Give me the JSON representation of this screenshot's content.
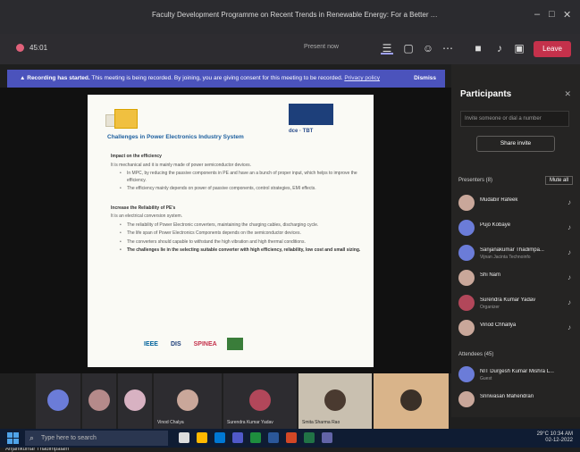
{
  "window": {
    "title": "Faculty Development Programme on Recent Trends in Renewable Energy: For a Better Tomorrow",
    "controls": [
      "–",
      "□",
      "✕"
    ]
  },
  "toolbar": {
    "timer": "45:01",
    "participants_search_hint": "Present now",
    "leave_label": "Leave"
  },
  "banner": {
    "bold": "Recording has started.",
    "text": "This meeting is being recorded. By joining, you are giving consent for this meeting to be recorded.",
    "link": "Privacy policy",
    "dismiss": "Dismiss"
  },
  "slide": {
    "heading": "Challenges in Power Electronics Industry System",
    "partners_text": "dce  ·  TBT",
    "section1_title": "Impact on the efficiency",
    "section1_text": "It is mechanical and it is mainly made of power semiconductor devices.",
    "bullets1": [
      "In MPC, by reducing the passive components in PE and have an a bunch of proper input, which helps to improve the efficiency.",
      "The efficiency mainly depends on power of passive components, control strategies, EMI effects."
    ],
    "section2_title": "Increase the Reliability of PE's",
    "section2_text": "It is an electrical conversion system.",
    "bullets2": [
      "The reliability of Power Electronic converters, maintaining the charging cables, discharging cycle.",
      "The life span of Power Electronics Components depends on the semiconductor devices.",
      "The converters should capable to withstand the high vibration and high thermal conditions.",
      "The challenges lie in the selecting suitable converter with high efficiency, reliability, low cost and small sizing."
    ],
    "footer_logos": [
      "IEEE",
      "DIS",
      "SPINEA"
    ]
  },
  "presenter_label": "Anjanikumar Thadimpalam",
  "panel": {
    "title": "Participants",
    "search_placeholder": "Invite someone or dial a number",
    "share_label": "Share invite",
    "presenters_label": "Presenters (8)",
    "mute_all": "Mute all",
    "attendees_label": "Attendees (45)",
    "participants": [
      {
        "name": "Mudabir Rafeek",
        "sub": ""
      },
      {
        "name": "Pujo Kobaye",
        "sub": ""
      },
      {
        "name": "Sanjanakumar Thadimpa...",
        "sub": "Vijnan Jacinta Technoinfo"
      },
      {
        "name": "Shi Nam",
        "sub": ""
      },
      {
        "name": "Surendra Kumar Yadav",
        "sub": "Organizer"
      },
      {
        "name": "Vinod Chhallya",
        "sub": ""
      }
    ],
    "attendees": [
      {
        "name": "NIT Durgesh Kumar Mishra L...",
        "sub": "Guest"
      },
      {
        "name": "Srinivasan Mahendran",
        "sub": ""
      }
    ]
  },
  "strip": {
    "tiles": [
      {
        "name": ""
      },
      {
        "name": ""
      },
      {
        "name": ""
      },
      {
        "name": "Vinod Chalya"
      },
      {
        "name": "Surendra Kumar Yadav"
      },
      {
        "name": "Smita Sharma Rao"
      },
      {
        "name": ""
      }
    ]
  },
  "taskbar": {
    "search_placeholder": "Type here to search",
    "time": "10:34 AM",
    "date": "02-12-2022",
    "temp": "29°C"
  },
  "colors": {
    "accent": "#4b53bc",
    "leave": "#c4314b",
    "panel_bg": "#252423"
  }
}
